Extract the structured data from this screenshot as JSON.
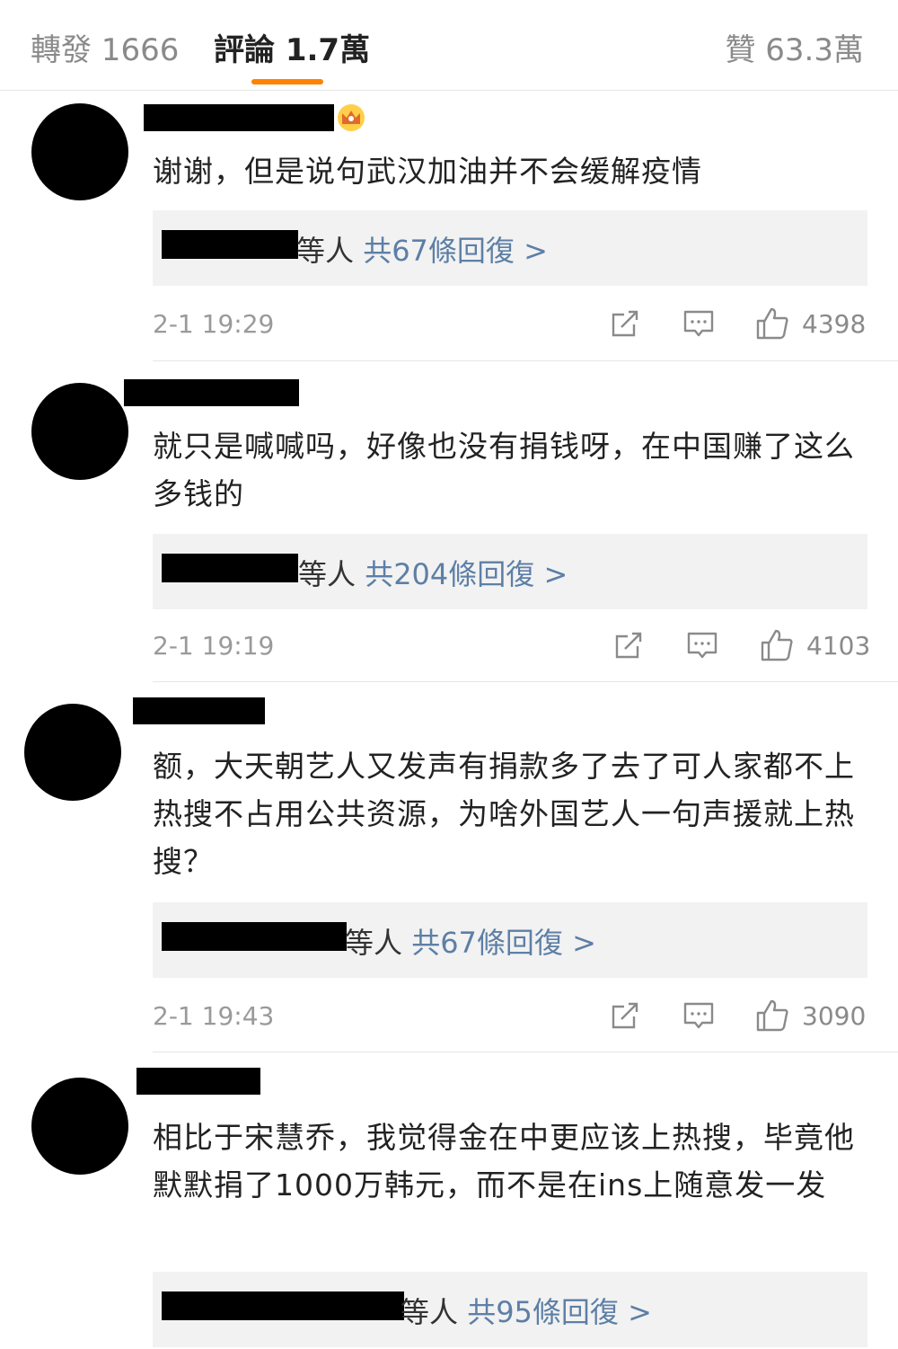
{
  "tabs": {
    "repost": "轉發 1666",
    "comments": "評論 1.7萬",
    "likes": "贊 63.3萬"
  },
  "comments": [
    {
      "text": "谢谢，但是说句武汉加油并不会缓解疫情",
      "reply_suffix": "等人",
      "reply_count": "共67條回復 >",
      "time": "2-1 19:29",
      "likes": "4398"
    },
    {
      "text": "就只是喊喊吗，好像也没有捐钱呀，在中国赚了这么多钱的",
      "reply_suffix": "等人",
      "reply_count": "共204條回復 >",
      "time": "2-1 19:19",
      "likes": "4103"
    },
    {
      "text": "额，大天朝艺人又发声有捐款多了去了可人家都不上热搜不占用公共资源，为啥外国艺人一句声援就上热搜？",
      "reply_suffix": "等人",
      "reply_count": "共67條回復 >",
      "time": "2-1 19:43",
      "likes": "3090"
    },
    {
      "text": "相比于宋慧乔，我觉得金在中更应该上热搜，毕竟他默默捐了1000万韩元，而不是在ins上随意发一发",
      "reply_suffix": "等人",
      "reply_count": "共95條回復 >"
    }
  ],
  "colors": {
    "accent": "#ff8200",
    "link": "#5d7fa6",
    "muted": "#9a9a9a"
  },
  "icons": [
    "crown-icon",
    "share-icon",
    "comment-icon",
    "thumbs-up-icon"
  ]
}
